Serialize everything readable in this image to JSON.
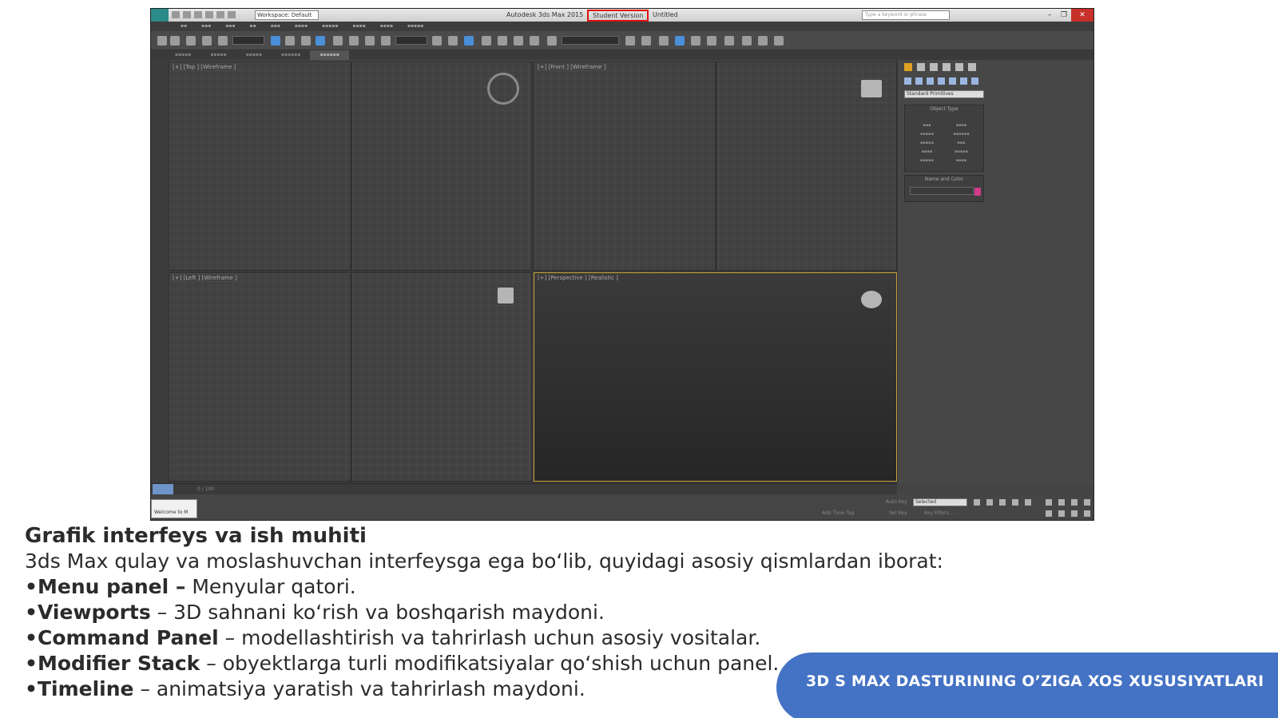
{
  "app": {
    "title_prefix": "Autodesk 3ds Max  2015",
    "student_label": "Student Version",
    "doc_name": "Untitled",
    "workspace": "Workspace: Default",
    "search_placeholder": "Type a keyword or phrase",
    "viewports": {
      "top": "[+] [Top ] [Wireframe ]",
      "front": "[+] [Front ] [Wireframe ]",
      "left": "[+] [Left ] [Wireframe ]",
      "perspective": "[+] [Perspective ] [Realistic ]"
    },
    "command_panel": {
      "category": "Standard Primitives",
      "object_type": "Object Type",
      "name_color": "Name and Color"
    },
    "timeline_frame": "0 / 100",
    "status": {
      "welcome": "Welcome to M",
      "selected_dropdown": "Selected",
      "auto_key": "Auto Key",
      "set_key": "Set Key",
      "key_filters": "Key Filters...",
      "add_time_tag": "Add Time Tag"
    }
  },
  "content": {
    "heading": "Grafik interfeys va ish muhiti",
    "intro": "3ds Max qulay va moslashuvchan interfeysga ega bo‘lib, quyidagi asosiy qismlardan iborat:",
    "items": [
      {
        "term": "•Menu panel –",
        "desc": " Menyular qatori."
      },
      {
        "term": "•Viewports",
        "desc": " – 3D sahnani ko‘rish va boshqarish maydoni."
      },
      {
        "term": "•Command Panel",
        "desc": " – modellashtirish va tahrirlash uchun asosiy vositalar."
      },
      {
        "term": "•Modifier Stack",
        "desc": " – obyektlarga turli modifikatsiyalar qo‘shish uchun panel."
      },
      {
        "term": "•Timeline",
        "desc": " – animatsiya yaratish va tahrirlash maydoni."
      }
    ]
  },
  "badge": "3D S MAX DASTURINING O’ZIGA XOS XUSUSIYATLARI",
  "colors": {
    "badge": "#4472c4",
    "student_highlight": "#e01010"
  }
}
